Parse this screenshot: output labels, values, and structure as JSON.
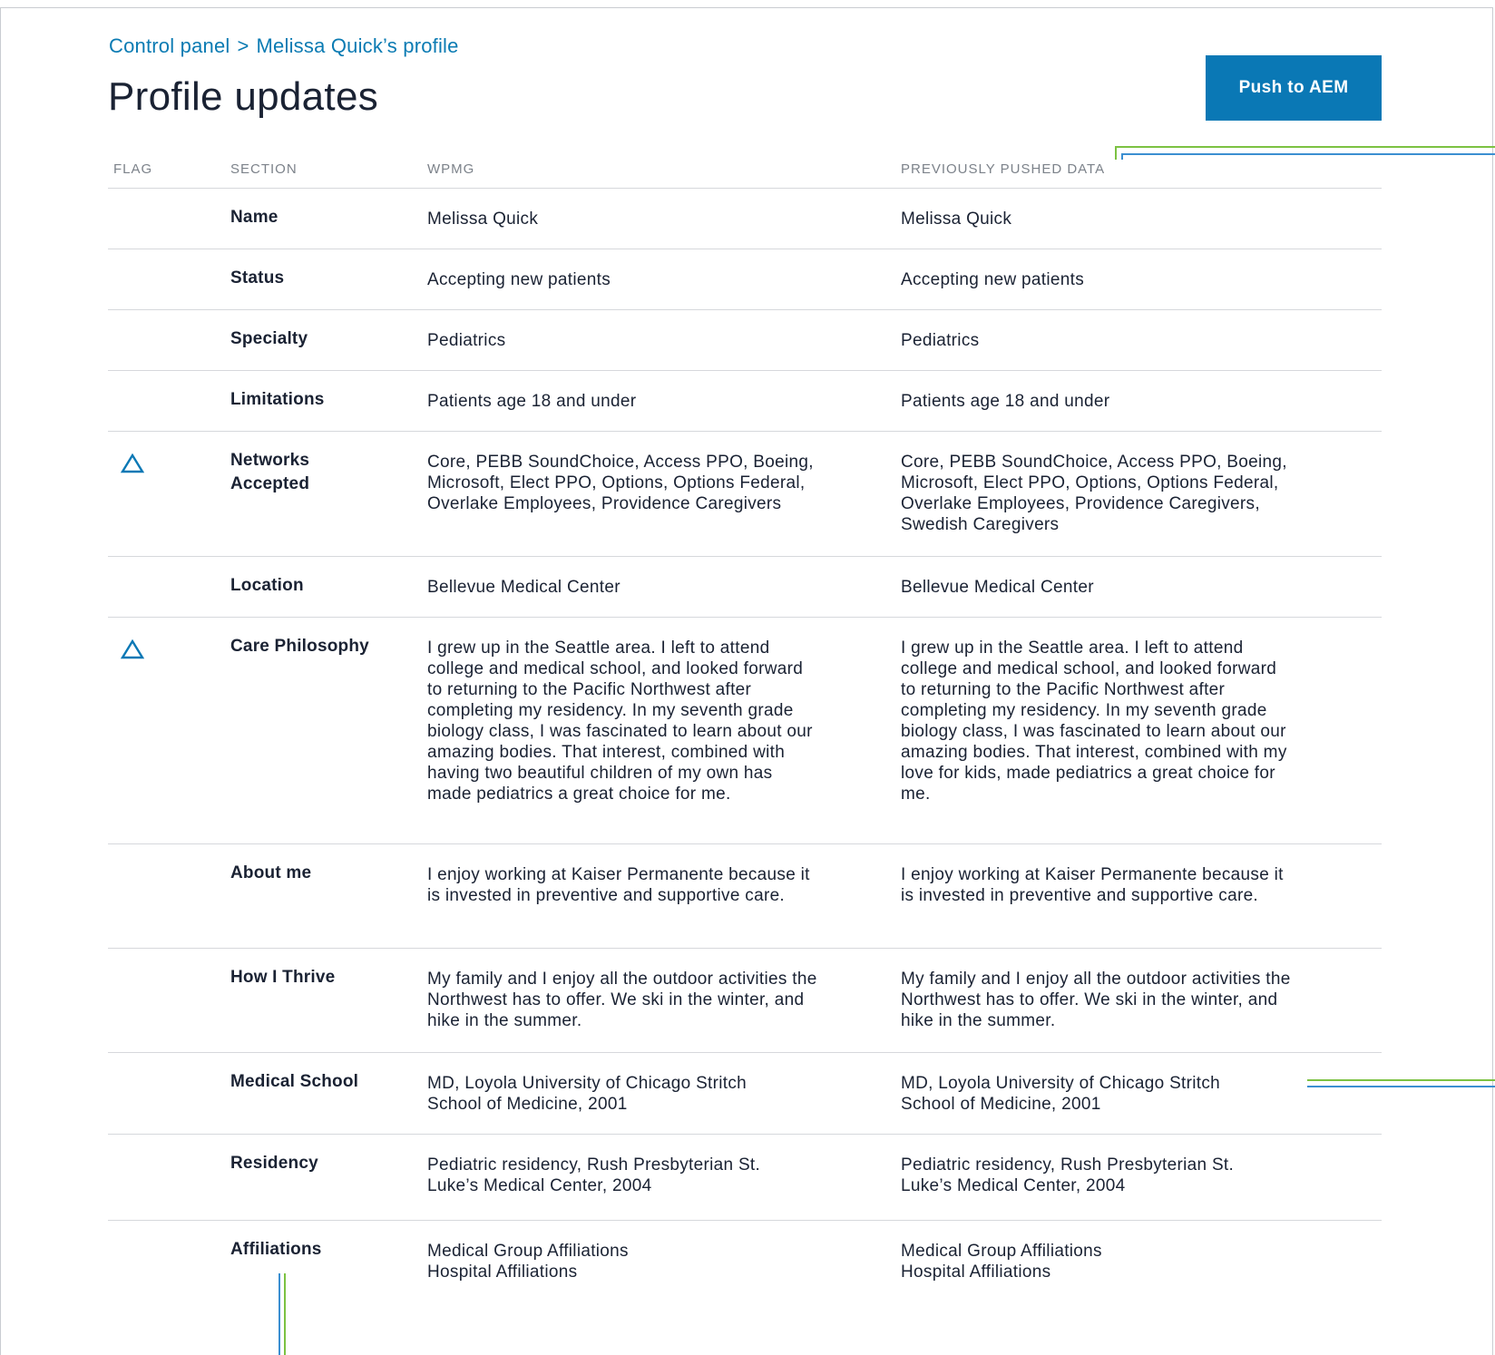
{
  "breadcrumb": {
    "root": "Control panel",
    "separator": ">",
    "current": "Melissa Quick’s profile"
  },
  "page": {
    "title": "Profile updates",
    "push_button_label": "Push to AEM"
  },
  "colors": {
    "accent_blue": "#0a78b5",
    "link_blue": "#0b7bb3",
    "guide_green": "#7cc242",
    "guide_blue": "#3b8fd1"
  },
  "table": {
    "headers": {
      "flag": "FLAG",
      "section": "SECTION",
      "wpmg": "WPMG",
      "previous": "PREVIOUSLY PUSHED DATA"
    },
    "rows": [
      {
        "flagged": false,
        "section": "Name",
        "wpmg": "Melissa Quick",
        "previous": "Melissa Quick"
      },
      {
        "flagged": false,
        "section": "Status",
        "wpmg": "Accepting new patients",
        "previous": "Accepting new patients"
      },
      {
        "flagged": false,
        "section": "Specialty",
        "wpmg": "Pediatrics",
        "previous": "Pediatrics"
      },
      {
        "flagged": false,
        "section": "Limitations",
        "wpmg": "Patients age 18 and under",
        "previous": "Patients age 18 and under"
      },
      {
        "flagged": true,
        "flag_icon": "warning-triangle-icon",
        "section": "Networks\nAccepted",
        "wpmg": "Core, PEBB SoundChoice, Access PPO, Boeing,\nMicrosoft, Elect PPO, Options, Options Federal,\nOverlake Employees, Providence Caregivers",
        "previous": "Core, PEBB SoundChoice, Access PPO, Boeing,\nMicrosoft, Elect PPO, Options, Options Federal,\nOverlake Employees, Providence Caregivers,\nSwedish Caregivers"
      },
      {
        "flagged": false,
        "section": "Location",
        "wpmg": "Bellevue Medical Center",
        "previous": "Bellevue Medical Center"
      },
      {
        "flagged": true,
        "flag_icon": "warning-triangle-icon",
        "section": "Care Philosophy",
        "wpmg": "I grew up in the Seattle area. I left to attend\ncollege and medical school, and looked forward\nto returning to the Pacific Northwest after\ncompleting my residency. In my seventh grade\nbiology class, I was fascinated to learn about our\namazing bodies. That interest, combined with\nhaving two beautiful children of my own has\nmade pediatrics a great choice for me.",
        "previous": "I grew up in the Seattle area. I left to attend\ncollege and medical school, and looked forward\nto returning to the Pacific Northwest after\ncompleting my residency. In my seventh grade\nbiology class, I was fascinated to learn about our\namazing bodies. That interest, combined with my\nlove for kids, made pediatrics a great choice for\nme."
      },
      {
        "flagged": false,
        "section": "About me",
        "wpmg": "I enjoy working at Kaiser Permanente because it\nis invested in preventive and supportive care.",
        "previous": "I enjoy working at Kaiser Permanente because it\nis invested in preventive and supportive care."
      },
      {
        "flagged": false,
        "section": "How I Thrive",
        "wpmg": "My family and I enjoy all the outdoor activities the\nNorthwest has to offer. We ski in the winter, and\nhike in the summer.",
        "previous": "My family and I enjoy all the outdoor activities the\nNorthwest has to offer. We ski in the winter, and\nhike in the summer."
      },
      {
        "flagged": false,
        "section": "Medical School",
        "wpmg": "MD, Loyola University of Chicago Stritch\nSchool of Medicine, 2001",
        "previous": "MD, Loyola University of Chicago Stritch\nSchool of Medicine, 2001"
      },
      {
        "flagged": false,
        "section": "Residency",
        "wpmg": "Pediatric residency, Rush Presbyterian St.\nLuke’s Medical Center, 2004",
        "previous": "Pediatric residency, Rush Presbyterian St.\nLuke’s Medical Center, 2004"
      },
      {
        "flagged": false,
        "section": "Affiliations",
        "wpmg": "Medical Group Affiliations\nHospital Affiliations",
        "previous": "Medical Group Affiliations\nHospital Affiliations"
      }
    ]
  }
}
